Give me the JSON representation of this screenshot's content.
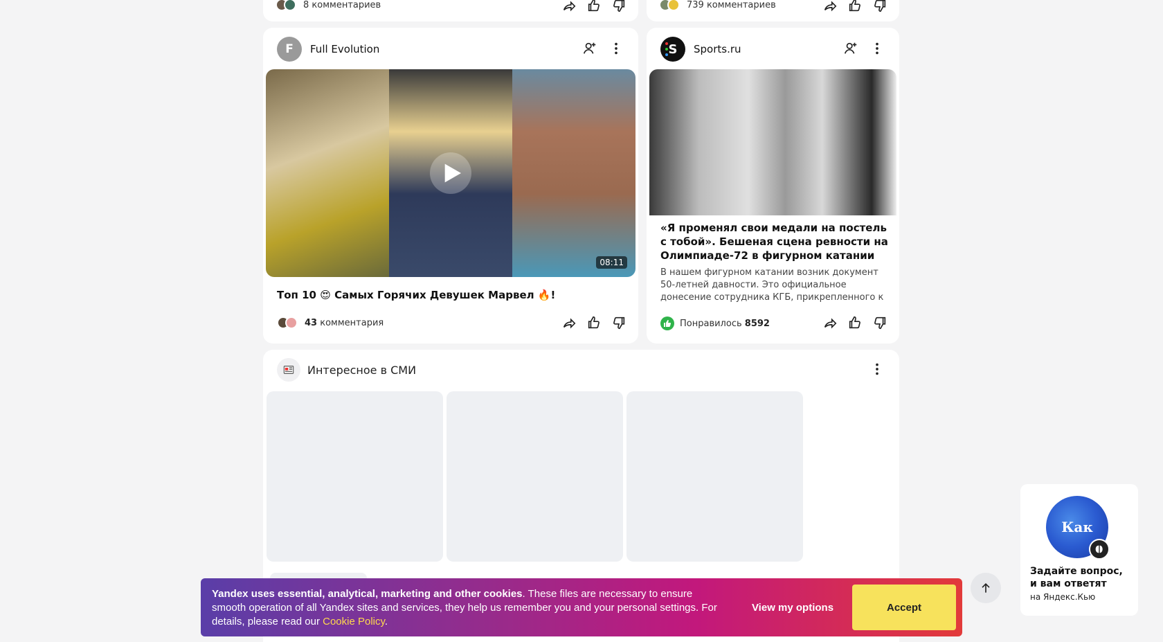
{
  "top_cards": {
    "left_comments": "8 комментариев",
    "right_comments": "739 комментариев"
  },
  "card_video": {
    "channel_initial": "F",
    "channel_name": "Full Evolution",
    "duration": "08:11",
    "title": "Топ 10 😍 Самых Горячих Девушек Марвел 🔥!",
    "comments_count": "43",
    "comments_label": "комментария"
  },
  "card_article": {
    "channel_name": "Sports.ru",
    "title": "«Я променял свои медали на постель с тобой». Бешеная сцена ревности на Олимпиаде-72 в фигурном катании",
    "snippet": "В нашем фигурном катании возник документ 50-летней давности. Это официальное донесение сотрудника КГБ, прикрепленного к советским...",
    "likes_label": "Понравилось",
    "likes_count": "8592"
  },
  "media_block": {
    "title": "Интересное в СМИ"
  },
  "question_widget": {
    "logo_text": "Как",
    "line1": "Задайте вопрос,",
    "line2": "и вам ответят",
    "subtitle": "на Яндекс.Кью"
  },
  "cookie_banner": {
    "bold_text": "Yandex uses essential, analytical, marketing and other cookies",
    "body_text": ". These files are necessary to ensure smooth operation of all Yandex sites and services, they help us remember you and your personal settings. For details, please read our ",
    "link_text": "Cookie Policy",
    "end_text": ".",
    "options_label": "View my options",
    "accept_label": "Accept"
  },
  "colors": {
    "accept_bg": "#f7e25c",
    "banner_gradient": [
      "#5a3ea8",
      "#c2187c",
      "#e23a3a"
    ],
    "like_green": "#2fb34a",
    "link": "#ffd84d"
  }
}
